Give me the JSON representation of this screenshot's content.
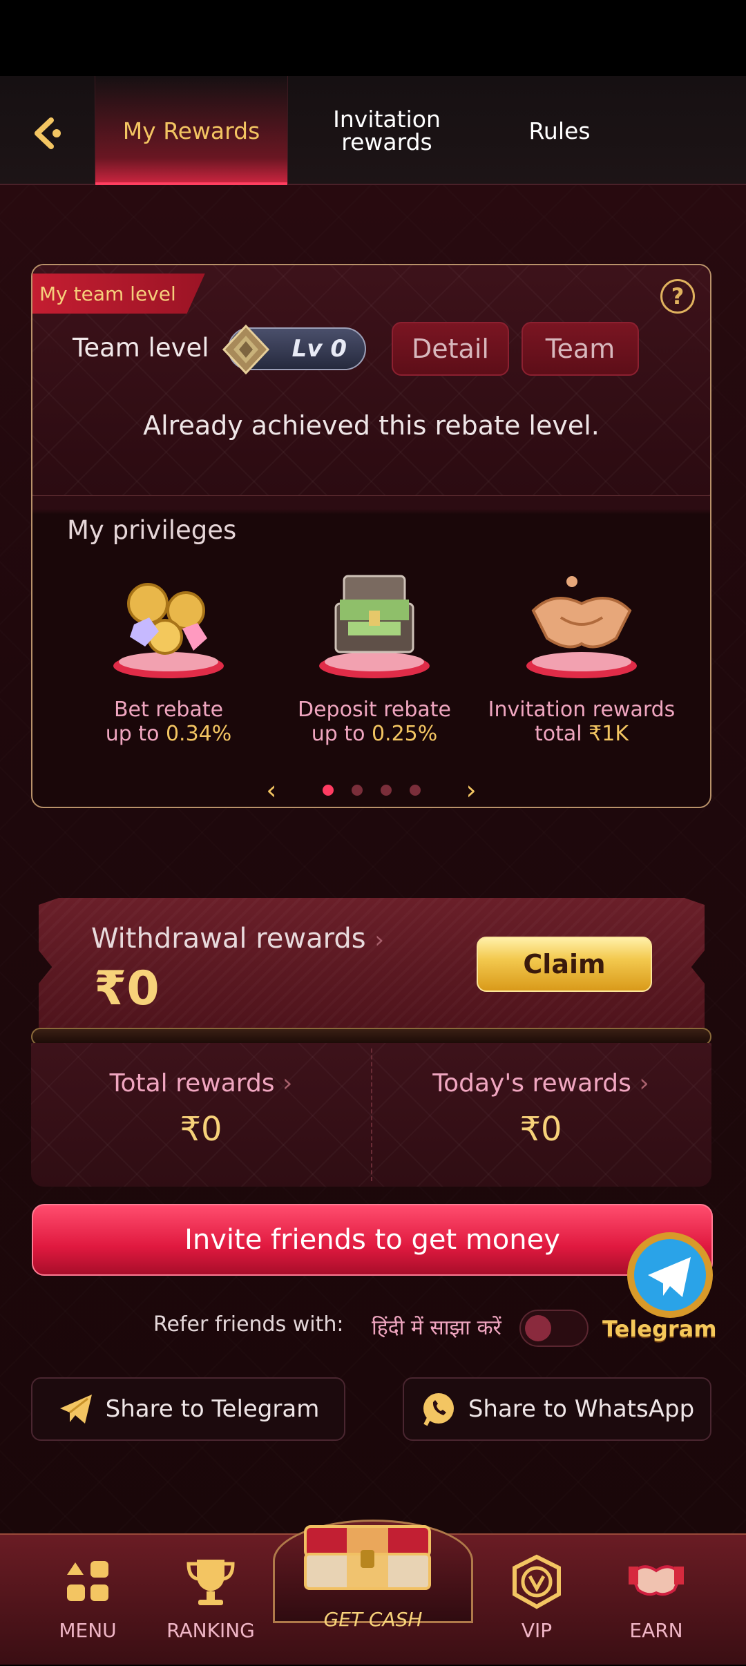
{
  "header": {
    "tabs": [
      {
        "label": "My Rewards"
      },
      {
        "label": "Invitation\nrewards"
      },
      {
        "label": "Rules"
      }
    ]
  },
  "team_card": {
    "ribbon": "My team level",
    "team_level_label": "Team level",
    "level_badge": "Lv 0",
    "detail_button": "Detail",
    "team_button": "Team",
    "achieved_text": "Already achieved this rebate level.",
    "privileges_title": "My privileges",
    "privileges": [
      {
        "name": "Bet rebate",
        "value_prefix": "up to ",
        "value": "0.34%"
      },
      {
        "name": "Deposit rebate",
        "value_prefix": "up to ",
        "value": "0.25%"
      },
      {
        "name": "Invitation rewards",
        "value_prefix": "total ",
        "value": "₹1K"
      }
    ],
    "pager": {
      "pages": 4,
      "active": 1
    }
  },
  "withdrawal": {
    "title": "Withdrawal rewards",
    "amount": "₹0",
    "claim_button": "Claim"
  },
  "totals": {
    "total_label": "Total rewards",
    "total_amount": "₹0",
    "today_label": "Today's rewards",
    "today_amount": "₹0"
  },
  "invite_button": "Invite friends to get money",
  "refer": {
    "label": "Refer friends with:",
    "hindi_label": "हिंदी में साझा करें"
  },
  "telegram_float_label": "Telegram",
  "share": {
    "telegram": "Share to Telegram",
    "whatsapp": "Share to WhatsApp"
  },
  "nav": {
    "menu": "MENU",
    "ranking": "RANKING",
    "get_cash": "GET CASH",
    "vip": "VIP",
    "earn": "EARN"
  },
  "colors": {
    "accent_gold": "#f3c562",
    "accent_red": "#e0193f",
    "pink_text": "#f0a6c0",
    "background": "#1f080c"
  }
}
